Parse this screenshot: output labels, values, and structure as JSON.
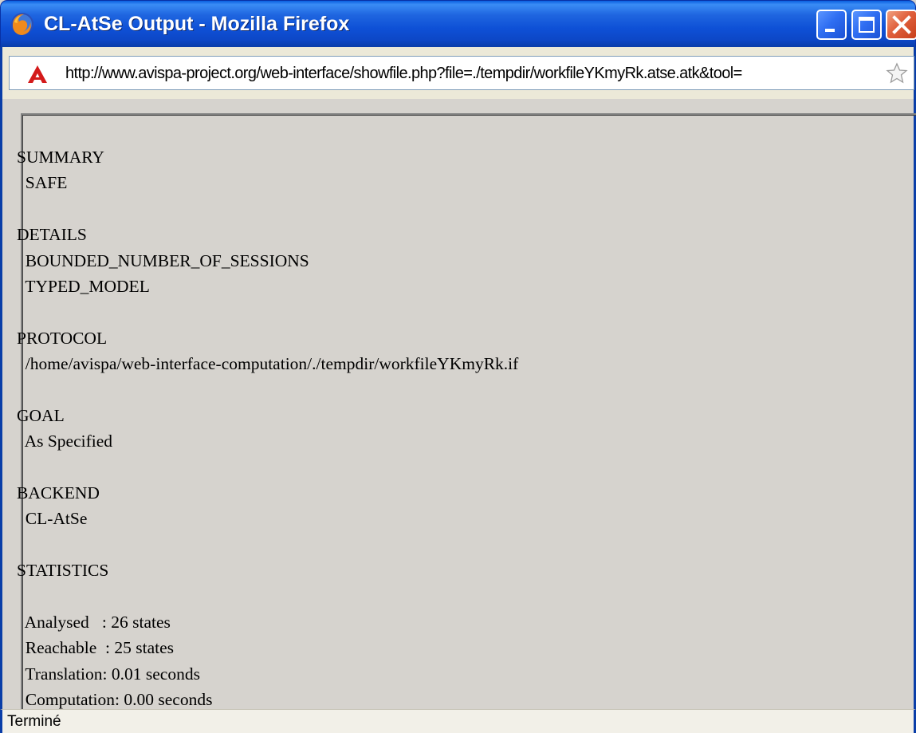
{
  "window": {
    "title": "CL-AtSe Output - Mozilla Firefox",
    "app_icon": "firefox-icon",
    "controls": {
      "minimize": "minimize-icon",
      "maximize": "maximize-icon",
      "close": "close-icon"
    }
  },
  "addressbar": {
    "url": "http://www.avispa-project.org/web-interface/showfile.php?file=./tempdir/workfileYKmyRk.atse.atk&tool=",
    "site_icon": "avispa-site-icon",
    "bookmark_icon": "star-icon"
  },
  "output": {
    "lines": [
      "SUMMARY",
      "  SAFE",
      "",
      "DETAILS",
      "  BOUNDED_NUMBER_OF_SESSIONS",
      "  TYPED_MODEL",
      "",
      "PROTOCOL",
      "  /home/avispa/web-interface-computation/./tempdir/workfileYKmyRk.if",
      "",
      "GOAL",
      "  As Specified",
      "",
      "BACKEND",
      "  CL-AtSe",
      "",
      "STATISTICS",
      "",
      "  Analysed   : 26 states",
      "  Reachable  : 25 states",
      "  Translation: 0.01 seconds",
      "  Computation: 0.00 seconds"
    ]
  },
  "statusbar": {
    "text": "Terminé"
  },
  "colors": {
    "titlebar": "#0d47c6",
    "content_bg": "#d6d3ce",
    "close_button": "#e0603c"
  }
}
